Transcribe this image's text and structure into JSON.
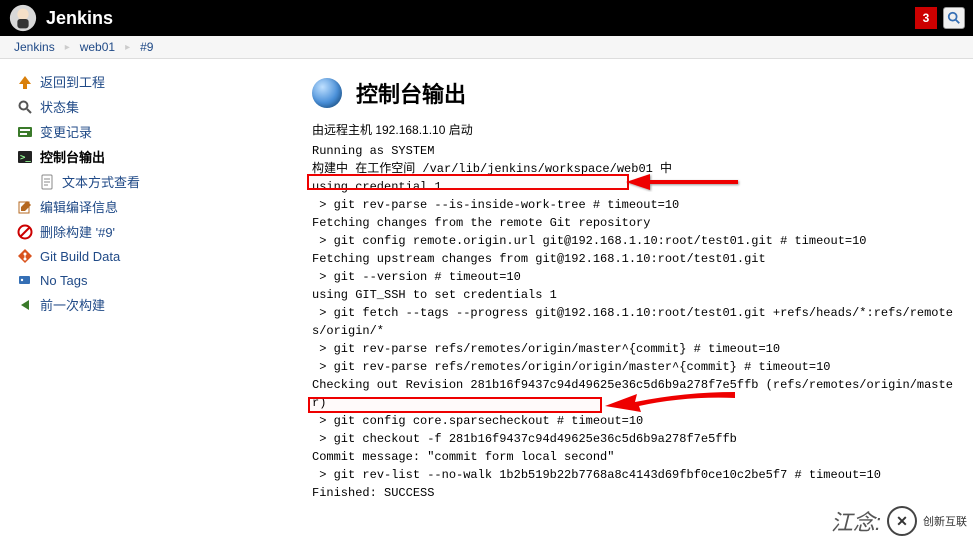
{
  "header": {
    "brand": "Jenkins",
    "notif_count": "3"
  },
  "breadcrumbs": [
    {
      "label": "Jenkins"
    },
    {
      "label": "web01"
    },
    {
      "label": "#9"
    }
  ],
  "sidebar": [
    {
      "key": "back",
      "label": "返回到工程",
      "icon": "up-arrow-icon",
      "color": "#d97f0a"
    },
    {
      "key": "status",
      "label": "状态集",
      "icon": "search-icon",
      "color": "#555"
    },
    {
      "key": "changes",
      "label": "变更记录",
      "icon": "changes-icon",
      "color": "#3a7a2a"
    },
    {
      "key": "console",
      "label": "控制台输出",
      "icon": "console-icon",
      "color": "#333",
      "active": true
    },
    {
      "key": "plaintext",
      "label": "文本方式查看",
      "icon": "document-icon",
      "color": "#888",
      "child": true
    },
    {
      "key": "editinfo",
      "label": "编辑编译信息",
      "icon": "edit-icon",
      "color": "#b56820"
    },
    {
      "key": "delete",
      "label": "删除构建 '#9'",
      "icon": "delete-icon",
      "color": "#c00"
    },
    {
      "key": "gitdata",
      "label": "Git Build Data",
      "icon": "git-icon",
      "color": "#d9531e"
    },
    {
      "key": "notags",
      "label": "No Tags",
      "icon": "tag-icon",
      "color": "#356fb5"
    },
    {
      "key": "prev",
      "label": "前一次构建",
      "icon": "prev-icon",
      "color": "#3a7a2a"
    }
  ],
  "page": {
    "title": "控制台输出",
    "intro": "由远程主机 192.168.1.10 启动"
  },
  "console_lines": [
    "Running as SYSTEM",
    "构建中 在工作空间 /var/lib/jenkins/workspace/web01 中",
    "using credential 1",
    " > git rev-parse --is-inside-work-tree # timeout=10",
    "Fetching changes from the remote Git repository",
    " > git config remote.origin.url git@192.168.1.10:root/test01.git # timeout=10",
    "Fetching upstream changes from git@192.168.1.10:root/test01.git",
    " > git --version # timeout=10",
    "using GIT_SSH to set credentials 1",
    " > git fetch --tags --progress git@192.168.1.10:root/test01.git +refs/heads/*:refs/remotes/origin/*",
    " > git rev-parse refs/remotes/origin/master^{commit} # timeout=10",
    " > git rev-parse refs/remotes/origin/origin/master^{commit} # timeout=10",
    "Checking out Revision 281b16f9437c94d49625e36c5d6b9a278f7e5ffb (refs/remotes/origin/master)",
    " > git config core.sparsecheckout # timeout=10",
    " > git checkout -f 281b16f9437c94d49625e36c5d6b9a278f7e5ffb",
    "Commit message: \"commit form local second\"",
    " > git rev-list --no-walk 1b2b519b22b7768a8c4143d69fbf0ce10c2be5f7 # timeout=10",
    "Finished: SUCCESS"
  ],
  "watermark": {
    "shortname": "江念:",
    "brand": "创新互联"
  }
}
